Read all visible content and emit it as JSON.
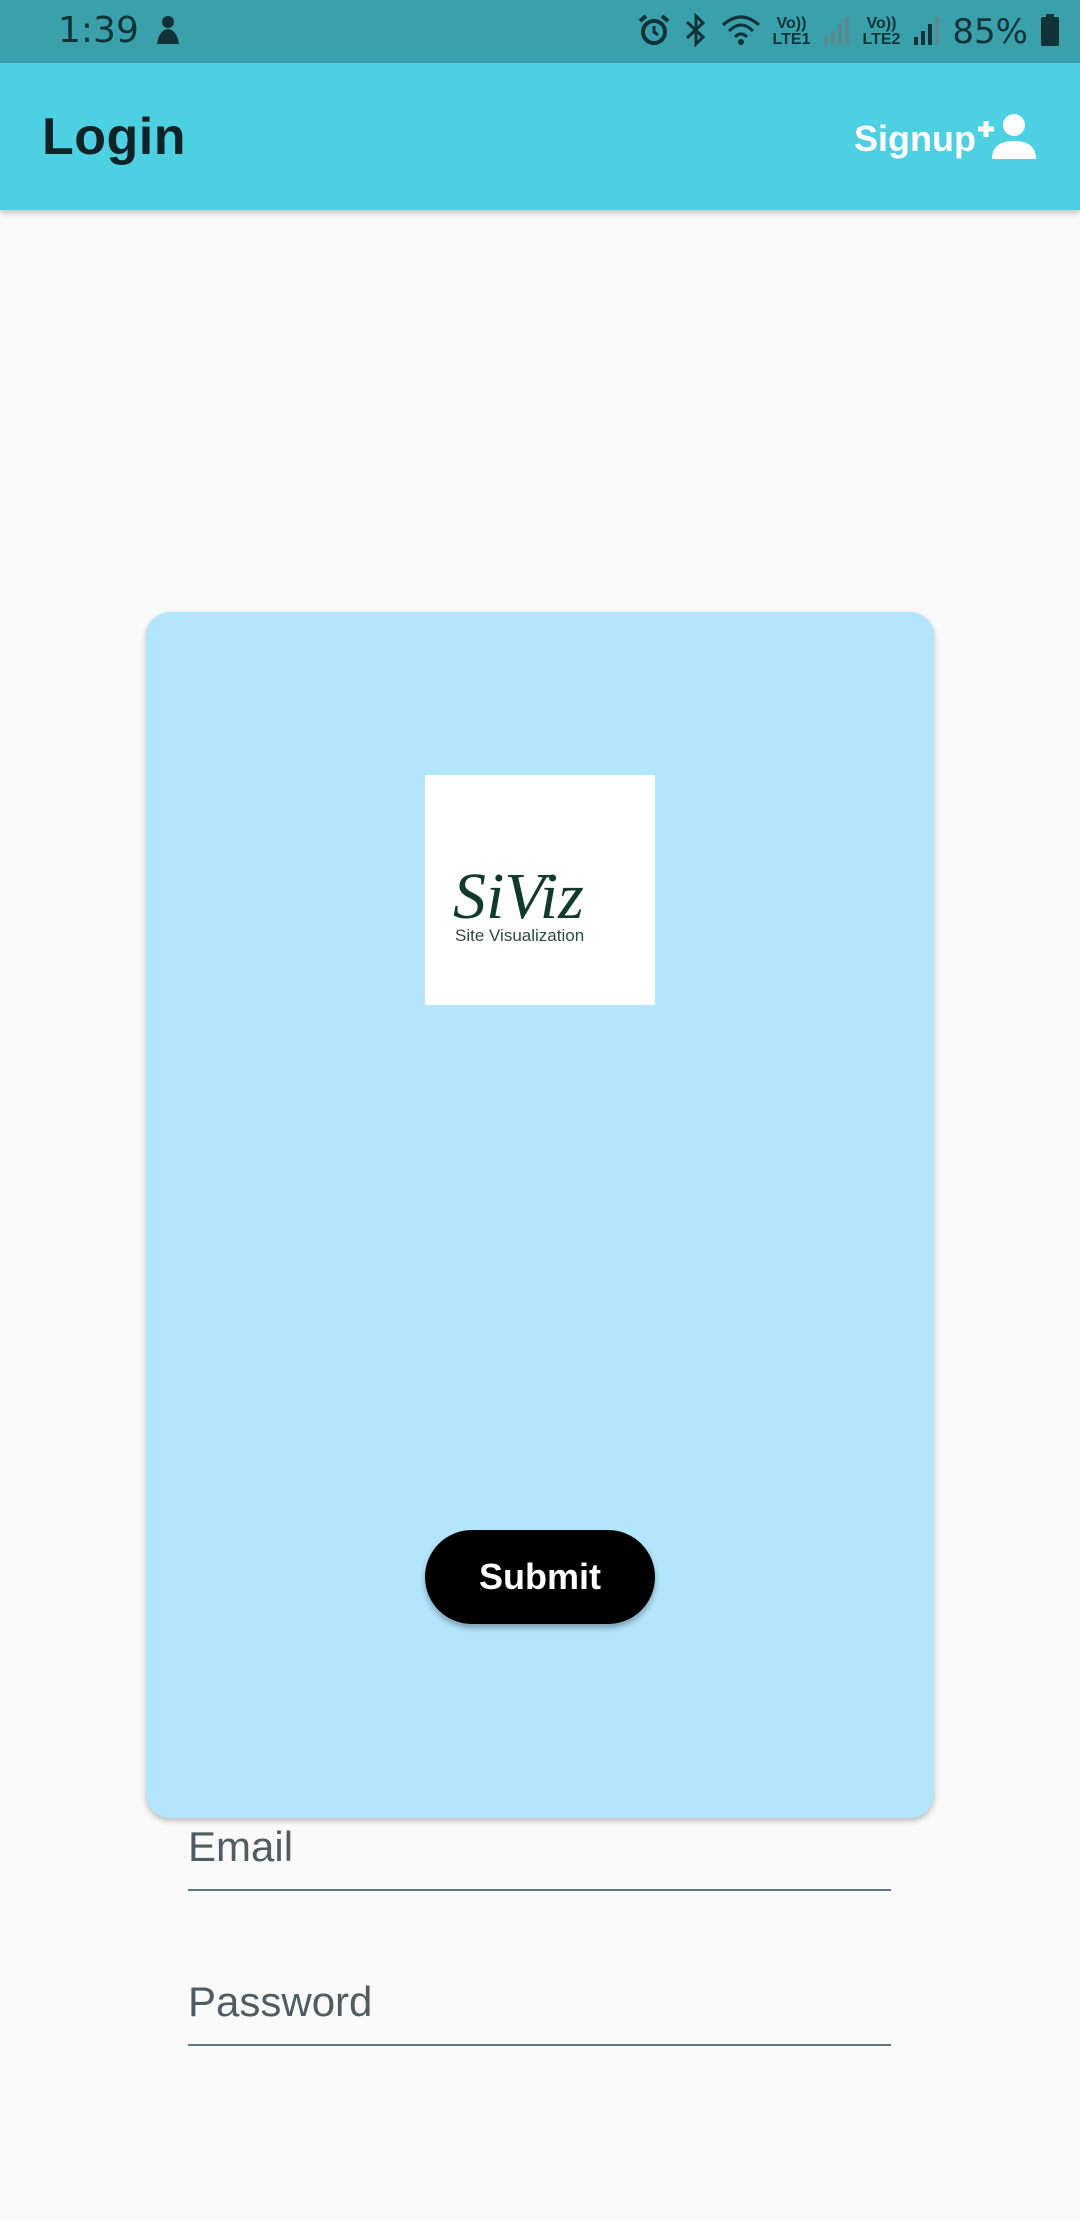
{
  "status_bar": {
    "time": "1:39",
    "lte1": "Vo))\nLTE1",
    "lte2": "Vo))\nLTE2",
    "battery": "85%",
    "icons": [
      "notification-icon",
      "alarm-icon",
      "bluetooth-icon",
      "wifi-icon",
      "signal-icon",
      "battery-icon"
    ]
  },
  "app_bar": {
    "title": "Login",
    "signup_label": "Signup",
    "signup_icon": "person-add-icon",
    "color": "#4dd0e1"
  },
  "card": {
    "color": "#b3e5fc",
    "logo": {
      "wordmark": "SiViz",
      "tagline": "Site Visualization"
    },
    "email_placeholder": "Email",
    "password_placeholder": "Password",
    "submit_label": "Submit"
  }
}
